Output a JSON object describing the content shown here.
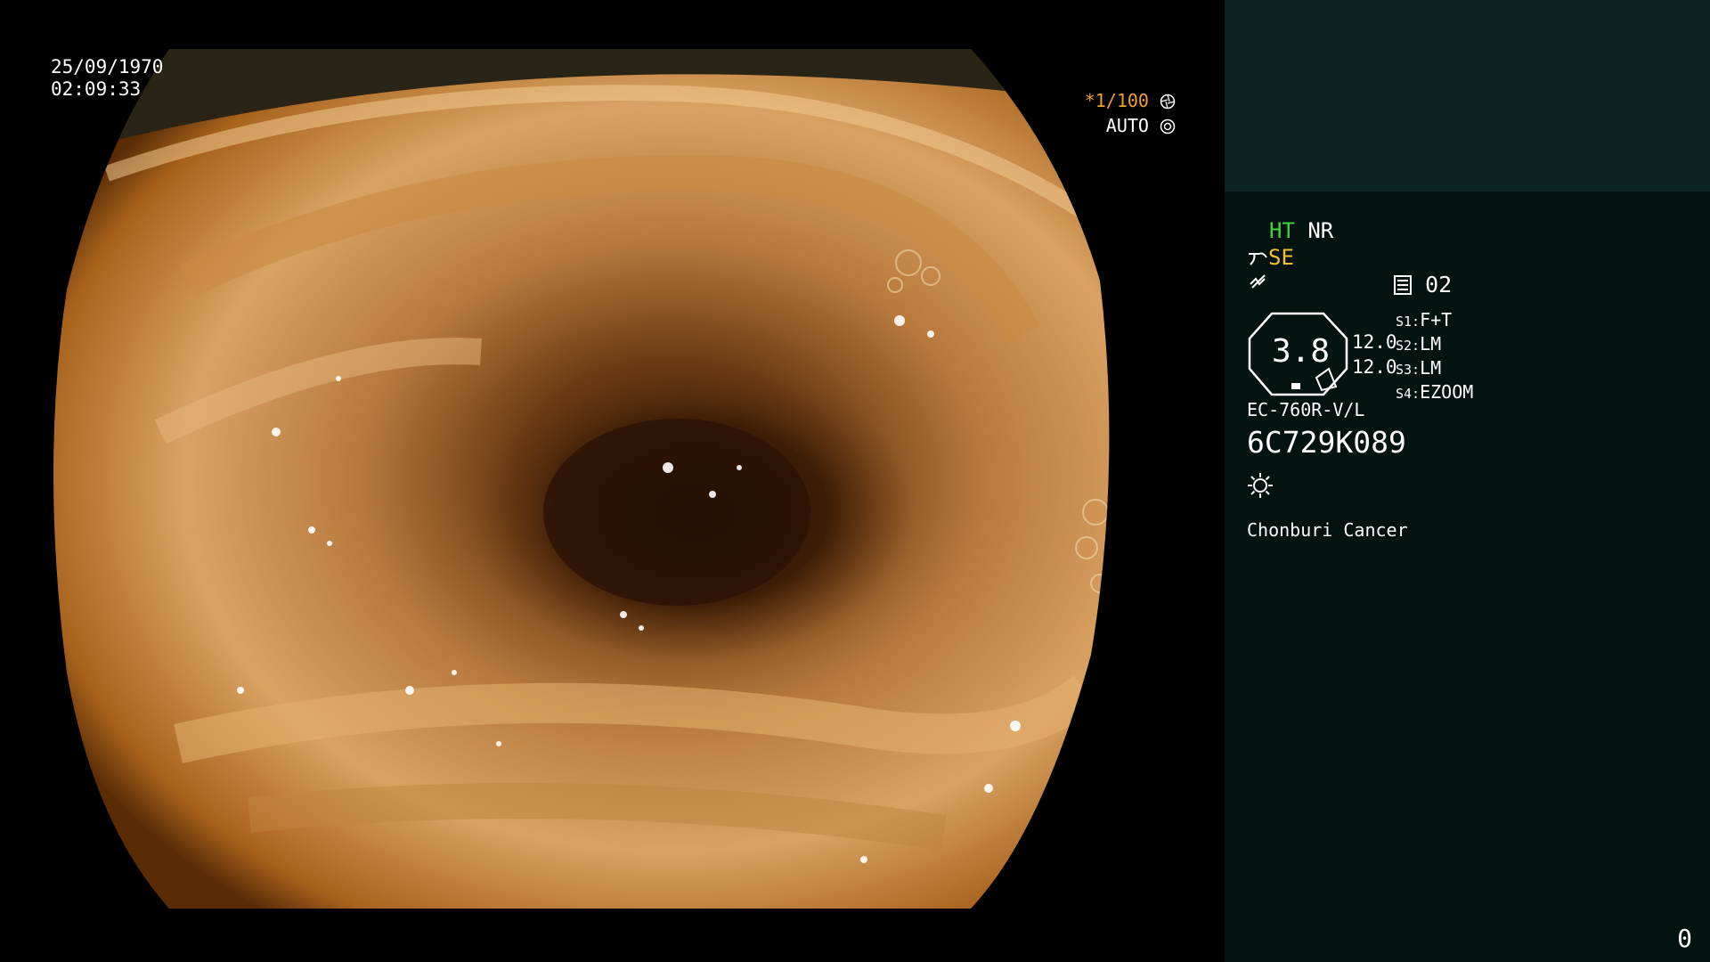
{
  "overlay": {
    "date": "25/09/1970",
    "time": "02:09:33",
    "shutter": "*1/100",
    "iris": "AUTO"
  },
  "panel": {
    "ht": "HT",
    "nr": "NR",
    "se": "SE",
    "memory": "02",
    "zoom_value": "3.8",
    "val_1": "12.0",
    "val_2": "12.0",
    "s1_key": "S1:",
    "s1_val": "F+T",
    "s2_key": "S2:",
    "s2_val": "LM",
    "s3_key": "S3:",
    "s3_val": "LM",
    "s4_key": "S4:",
    "s4_val": "EZOOM",
    "scope_model": "EC-760R-V/L",
    "serial": "6C729K089",
    "institution": "Chonburi Cancer",
    "frame_counter": "0"
  },
  "colors": {
    "panel_bg": "#041210",
    "panel_top": "#0c2424",
    "accent_green": "#3ed43e",
    "accent_amber": "#f0c030",
    "accent_orange": "#f0a030"
  },
  "icons": [
    "shutter-icon",
    "iris-icon",
    "enhancement-icon",
    "waveform-icon",
    "memory-icon",
    "light-icon"
  ]
}
